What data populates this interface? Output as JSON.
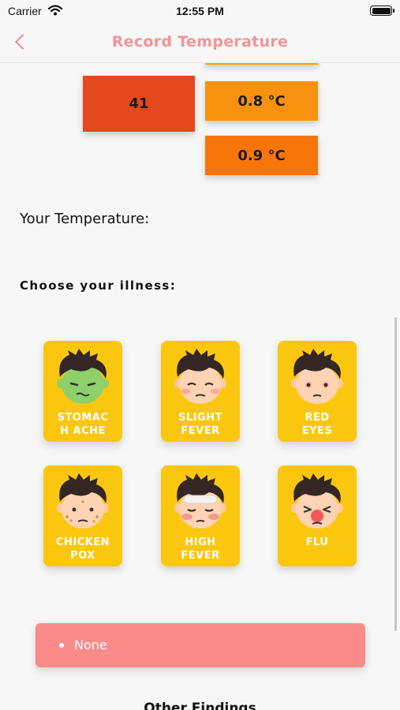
{
  "status_bar": {
    "carrier": "Carrier",
    "time": "12:55 PM"
  },
  "nav": {
    "title": "Record Temperature"
  },
  "temperature_scale": {
    "value_41": "41",
    "value_0_8": "0.8 °C",
    "value_0_9": "0.9 °C"
  },
  "form": {
    "your_temperature_label": "Your Temperature:",
    "choose_illness_label": "Choose your illness:"
  },
  "illnesses": [
    {
      "label": "STOMAC\nH ACHE",
      "icon": "stomach-ache-face"
    },
    {
      "label": "SLIGHT\nFEVER",
      "icon": "slight-fever-face"
    },
    {
      "label": "RED\nEYES",
      "icon": "red-eyes-face"
    },
    {
      "label": "CHICKEN\nPOX",
      "icon": "chicken-pox-face"
    },
    {
      "label": "HIGH\nFEVER",
      "icon": "high-fever-face"
    },
    {
      "label": "FLU",
      "icon": "flu-face"
    }
  ],
  "selection": {
    "none_label": "None"
  },
  "other_findings": {
    "title": "Other Findings"
  },
  "colors": {
    "accent": "#f39494",
    "card": "#fbc70e",
    "none_bar": "#f98b8b",
    "temp_41": "#e5481c",
    "temp_08": "#f8920e",
    "temp_09": "#f8750a"
  }
}
